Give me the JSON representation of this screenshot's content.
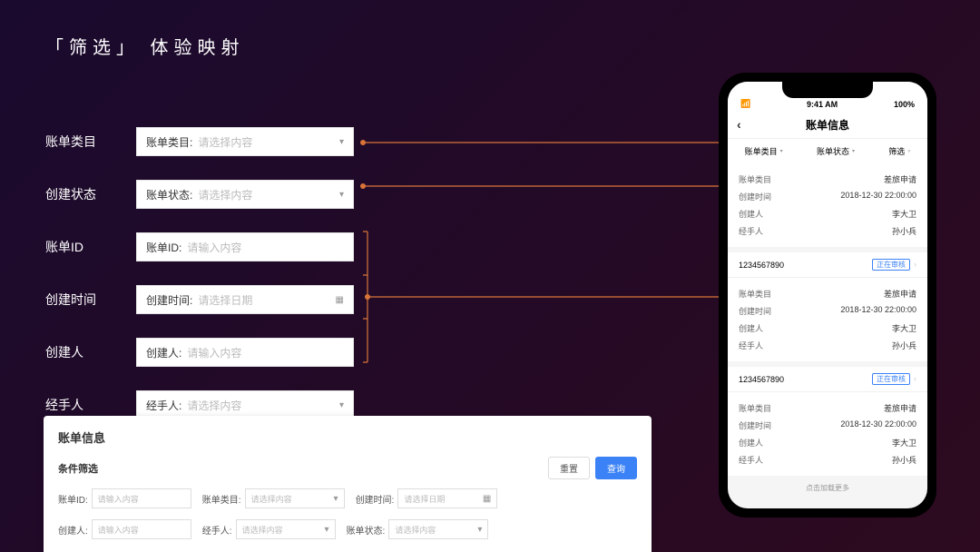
{
  "title": "「筛选」 体验映射",
  "form": {
    "rows": [
      {
        "label": "账单类目",
        "prefix": "账单类目:",
        "placeholder": "请选择内容",
        "icon": "chevron"
      },
      {
        "label": "创建状态",
        "prefix": "账单状态:",
        "placeholder": "请选择内容",
        "icon": "chevron"
      },
      {
        "label": "账单ID",
        "prefix": "账单ID:",
        "placeholder": "请输入内容",
        "icon": ""
      },
      {
        "label": "创建时间",
        "prefix": "创建时间:",
        "placeholder": "请选择日期",
        "icon": "calendar"
      },
      {
        "label": "创建人",
        "prefix": "创建人:",
        "placeholder": "请输入内容",
        "icon": ""
      },
      {
        "label": "经手人",
        "prefix": "经手人:",
        "placeholder": "请选择内容",
        "icon": "chevron"
      }
    ]
  },
  "phone": {
    "status": {
      "time": "9:41 AM",
      "battery": "100%"
    },
    "nav_title": "账单信息",
    "tabs": [
      {
        "label": "账单类目"
      },
      {
        "label": "账单状态"
      },
      {
        "label": "筛选"
      }
    ],
    "cards": [
      {
        "rows": [
          {
            "k": "账单类目",
            "v": "差旅申请"
          },
          {
            "k": "创建时间",
            "v": "2018-12-30 22:00:00"
          },
          {
            "k": "创建人",
            "v": "李大卫"
          },
          {
            "k": "经手人",
            "v": "孙小兵"
          }
        ]
      },
      {
        "id": "1234567890",
        "badge": "正在审核",
        "rows": [
          {
            "k": "账单类目",
            "v": "差旅申请"
          },
          {
            "k": "创建时间",
            "v": "2018-12-30 22:00:00"
          },
          {
            "k": "创建人",
            "v": "李大卫"
          },
          {
            "k": "经手人",
            "v": "孙小兵"
          }
        ]
      },
      {
        "id": "1234567890",
        "badge": "正在审核",
        "rows": [
          {
            "k": "账单类目",
            "v": "差旅申请"
          },
          {
            "k": "创建时间",
            "v": "2018-12-30 22:00:00"
          },
          {
            "k": "创建人",
            "v": "李大卫"
          },
          {
            "k": "经手人",
            "v": "孙小兵"
          }
        ]
      }
    ],
    "loadmore": "点击加载更多"
  },
  "panel": {
    "title": "账单信息",
    "subtitle": "条件筛选",
    "reset": "重置",
    "submit": "查询",
    "fields": [
      {
        "label": "账单ID:",
        "placeholder": "请输入内容",
        "icon": ""
      },
      {
        "label": "账单类目:",
        "placeholder": "请选择内容",
        "icon": "chevron"
      },
      {
        "label": "创建时间:",
        "placeholder": "请选择日期",
        "icon": "calendar"
      },
      {
        "label": "创建人:",
        "placeholder": "请输入内容",
        "icon": ""
      },
      {
        "label": "经手人:",
        "placeholder": "请选择内容",
        "icon": "chevron"
      },
      {
        "label": "账单状态:",
        "placeholder": "请选择内容",
        "icon": "chevron"
      }
    ]
  },
  "connector_color": "#d97438"
}
